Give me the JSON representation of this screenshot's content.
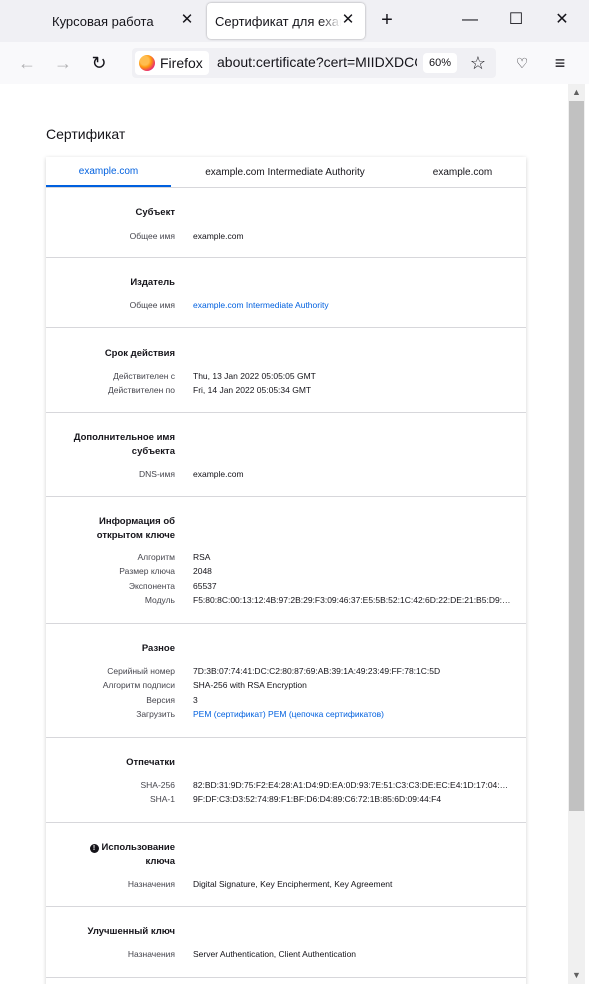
{
  "tabs": [
    {
      "title": "Курсовая работа",
      "close": "✕"
    },
    {
      "title": "Сертификат для example.com",
      "close": "✕"
    }
  ],
  "newtab_glyph": "+",
  "window_controls": {
    "minimize": "—",
    "maximize": "☐",
    "close": "✕"
  },
  "nav": {
    "back": "←",
    "forward": "→",
    "reload": "↻"
  },
  "urlbar": {
    "identity_label": "Firefox",
    "url": "about:certificate?cert=MIIDXDCCAkSgAwIBAgIU",
    "zoom": "60%",
    "bookmark": "☆"
  },
  "toolbar": {
    "pocket": "♡",
    "menu": "≡"
  },
  "scrollbar": {
    "up": "▲",
    "down": "▼"
  },
  "page": {
    "title": "Сертификат",
    "cert_tabs": [
      "example.com",
      "example.com Intermediate Authority",
      "example.com"
    ],
    "sections": [
      {
        "title": "Субъект",
        "rows": [
          {
            "k": "Общее имя",
            "v": "example.com"
          }
        ]
      },
      {
        "title": "Издатель",
        "rows": [
          {
            "k": "Общее имя",
            "v": "example.com Intermediate Authority"
          }
        ]
      },
      {
        "title": "Срок действия",
        "rows": [
          {
            "k": "Действителен с",
            "v": "Thu, 13 Jan 2022 05:05:05 GMT"
          },
          {
            "k": "Действителен по",
            "v": "Fri, 14 Jan 2022 05:05:34 GMT"
          }
        ]
      },
      {
        "title": "Дополнительное имя субъекта",
        "rows": [
          {
            "k": "DNS-имя",
            "v": "example.com"
          }
        ]
      },
      {
        "title": "Информация об открытом ключе",
        "rows": [
          {
            "k": "Алгоритм",
            "v": "RSA"
          },
          {
            "k": "Размер ключа",
            "v": "2048"
          },
          {
            "k": "Экспонента",
            "v": "65537"
          },
          {
            "k": "Модуль",
            "v": "F5:80:8C:00:13:12:4B:97:2B:29:F3:09:46:37:E5:5B:52:1C:42:6D:22:DE:21:B5:D9:5..."
          }
        ]
      },
      {
        "title": "Разное",
        "rows": [
          {
            "k": "Серийный номер",
            "v": "7D:3B:07:74:41:DC:C2:80:87:69:AB:39:1A:49:23:49:FF:78:1C:5D"
          },
          {
            "k": "Алгоритм подписи",
            "v": "SHA-256 with RSA Encryption"
          },
          {
            "k": "Версия",
            "v": "3"
          },
          {
            "k": "Загрузить",
            "v": "PEM (сертификат) PEM (цепочка сертификатов)"
          }
        ]
      },
      {
        "title": "Отпечатки",
        "rows": [
          {
            "k": "SHA-256",
            "v": "82:BD:31:9D:75:F2:E4:28:A1:D4:9D:EA:0D:93:7E:51:C3:C3:DE:EC:E4:1D:17:04:2..."
          },
          {
            "k": "SHA-1",
            "v": "9F:DF:C3:D3:52:74:89:F1:BF:D6:D4:89:C6:72:1B:85:6D:09:44:F4"
          }
        ]
      },
      {
        "title": "Использование ключа",
        "rows": [
          {
            "k": "Назначения",
            "v": "Digital Signature, Key Encipherment, Key Agreement"
          }
        ]
      },
      {
        "title": "Улучшенный ключ",
        "rows": [
          {
            "k": "Назначения",
            "v": "Server Authentication, Client Authentication"
          }
        ]
      }
    ]
  },
  "colors": {
    "accent": "#0060df",
    "tabstrip": "#f0f0f4",
    "text": "#15141a"
  },
  "icons": {
    "critical_info": "!"
  }
}
